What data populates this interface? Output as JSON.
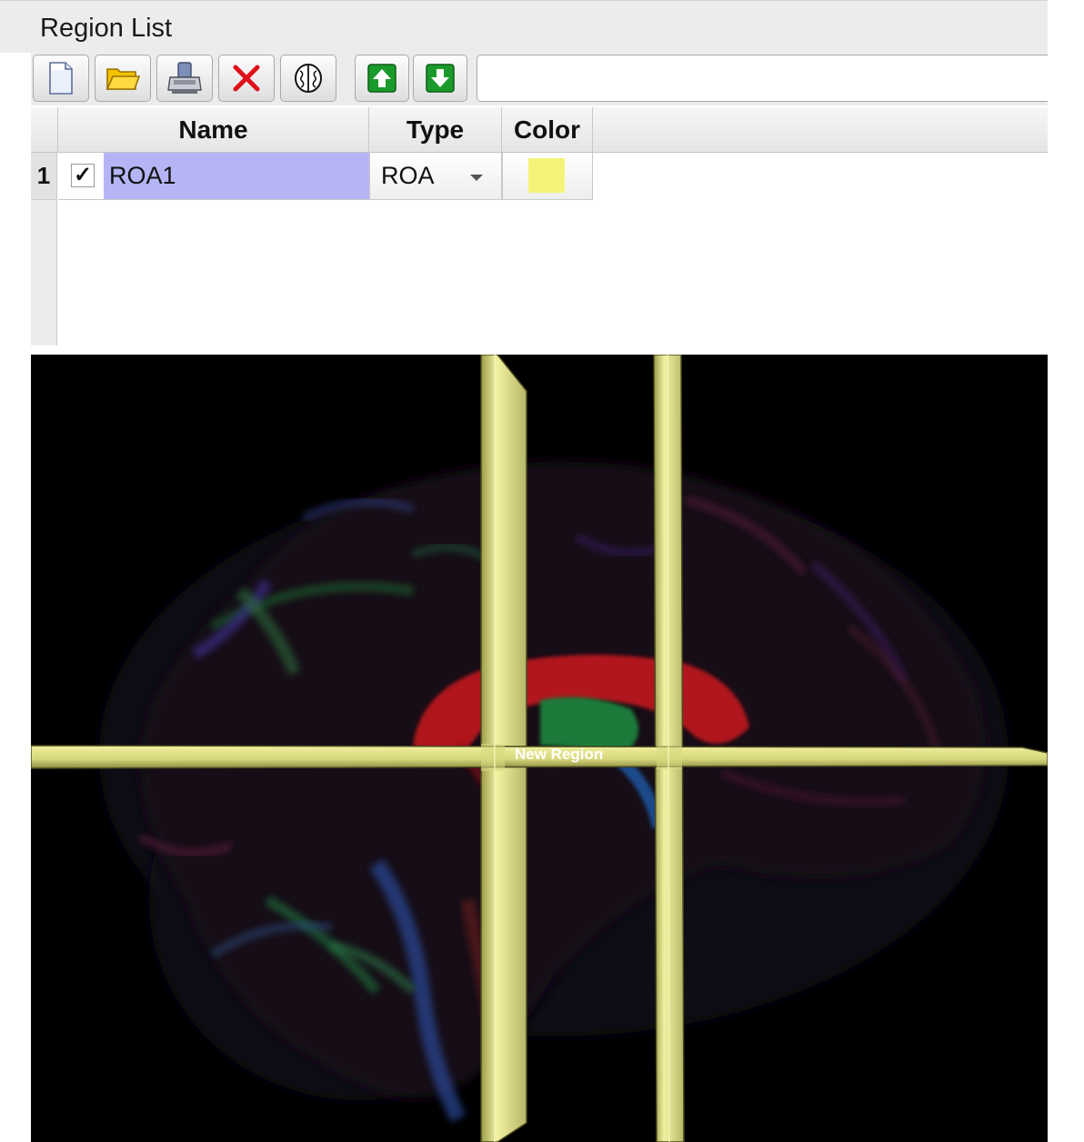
{
  "panel": {
    "title": "Region List"
  },
  "toolbar": {
    "buttons": [
      {
        "name": "new-region-button",
        "icon": "new-document-icon"
      },
      {
        "name": "open-region-button",
        "icon": "folder-open-icon"
      },
      {
        "name": "save-region-button",
        "icon": "save-disk-icon"
      },
      {
        "name": "delete-region-button",
        "icon": "red-x-icon"
      },
      {
        "name": "brain-region-button",
        "icon": "brain-icon"
      },
      {
        "name": "move-up-button",
        "icon": "green-up-arrow-icon"
      },
      {
        "name": "move-down-button",
        "icon": "green-down-arrow-icon"
      }
    ],
    "field_value": ""
  },
  "table": {
    "columns": [
      "Name",
      "Type",
      "Color"
    ],
    "rows": [
      {
        "index": "1",
        "checked": "✓",
        "name": "ROA1",
        "type": "ROA",
        "color": "#f5f47a"
      }
    ]
  },
  "viewport": {
    "label": "New Region",
    "background": "#000000",
    "roi_color": "#e6e68a"
  }
}
